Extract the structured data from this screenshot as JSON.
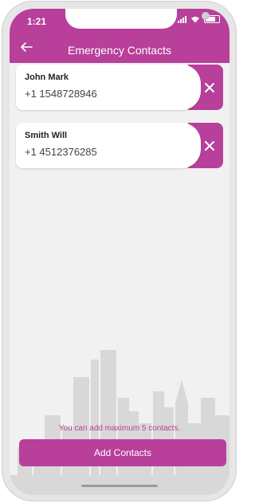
{
  "status_bar": {
    "time": "1:21"
  },
  "header": {
    "title": "Emergency Contacts"
  },
  "contacts": [
    {
      "name": "John Mark",
      "phone": "+1 1548728946"
    },
    {
      "name": "Smith Will",
      "phone": "+1 4512376285"
    }
  ],
  "notice": "You can add maximum 5 contacts.",
  "add_button_label": "Add Contacts",
  "colors": {
    "accent": "#b83f9a",
    "background": "#f1f1f1",
    "skyline": "#d6d6d6"
  }
}
